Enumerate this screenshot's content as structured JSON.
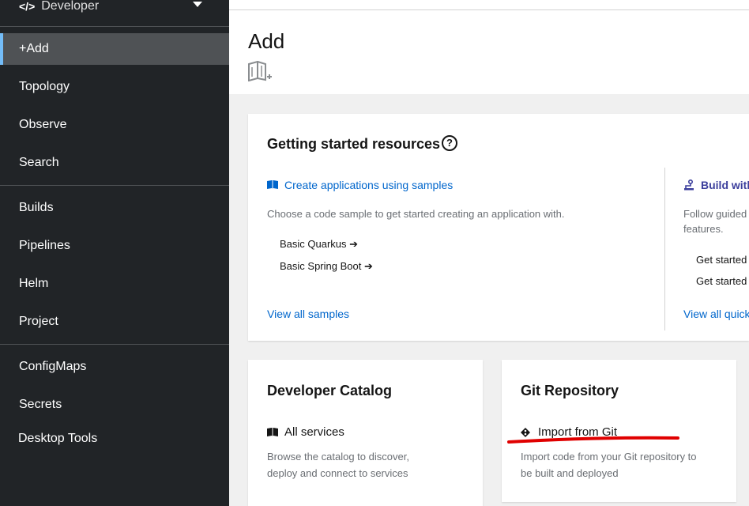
{
  "sidebar": {
    "perspective": "Developer",
    "items": [
      {
        "label": "+Add",
        "active": true
      },
      {
        "label": "Topology"
      },
      {
        "label": "Observe"
      },
      {
        "label": "Search"
      },
      {
        "label": "Builds"
      },
      {
        "label": "Pipelines"
      },
      {
        "label": "Helm"
      },
      {
        "label": "Project"
      },
      {
        "label": "ConfigMaps"
      },
      {
        "label": "Secrets"
      },
      {
        "label": "Desktop Tools"
      }
    ]
  },
  "header": {
    "title": "Add"
  },
  "getting_started": {
    "title": "Getting started resources",
    "samples": {
      "link": "Create applications using samples",
      "description": "Choose a code sample to get started creating an application with.",
      "items": [
        "Basic Quarkus",
        "Basic Spring Boot"
      ],
      "view_all": "View all samples"
    },
    "guided": {
      "link": "Build with",
      "description": "Follow guided",
      "description2": "features.",
      "items": [
        "Get started",
        "Get started"
      ],
      "view_all": "View all quick"
    }
  },
  "developer_catalog": {
    "title": "Developer Catalog",
    "link": "All services",
    "description": "Browse the catalog to discover, deploy and connect to services"
  },
  "git_repository": {
    "title": "Git Repository",
    "link": "Import from Git",
    "description": "Import code from your Git repository to be built and deployed"
  },
  "colors": {
    "accent": "#73bcf7",
    "link": "#0066cc",
    "annotation": "#e00000"
  }
}
